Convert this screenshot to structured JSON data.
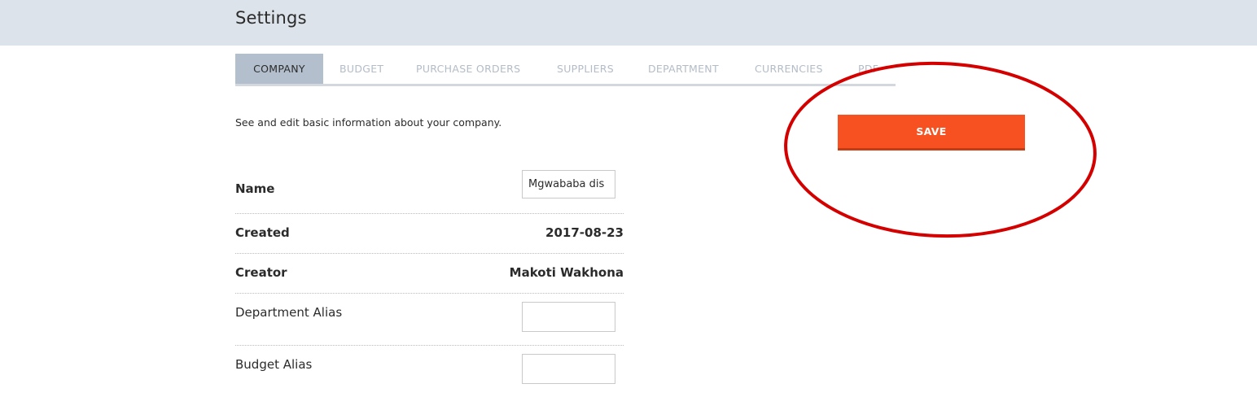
{
  "header": {
    "title": "Settings"
  },
  "tabs": [
    {
      "label": "COMPANY",
      "active": true
    },
    {
      "label": "BUDGET",
      "active": false
    },
    {
      "label": "PURCHASE ORDERS",
      "active": false
    },
    {
      "label": "SUPPLIERS",
      "active": false
    },
    {
      "label": "DEPARTMENT",
      "active": false
    },
    {
      "label": "CURRENCIES",
      "active": false
    },
    {
      "label": "PDF",
      "active": false
    }
  ],
  "company": {
    "description": "See and edit basic information about your company.",
    "save_label": "SAVE",
    "fields": {
      "name": {
        "label": "Name",
        "value": "Mgwababa dis"
      },
      "created": {
        "label": "Created",
        "value": "2017-08-23"
      },
      "creator": {
        "label": "Creator",
        "value": "Makoti Wakhona"
      },
      "department_alias": {
        "label": "Department Alias",
        "value": ""
      },
      "budget_alias": {
        "label": "Budget Alias",
        "value": ""
      }
    }
  },
  "colors": {
    "header_bg": "#dde3ea",
    "active_tab_bg": "#b3bfcd",
    "inactive_tab_text": "#b3bcc7",
    "save_button": "#f75122",
    "annotation": "#d40000"
  }
}
